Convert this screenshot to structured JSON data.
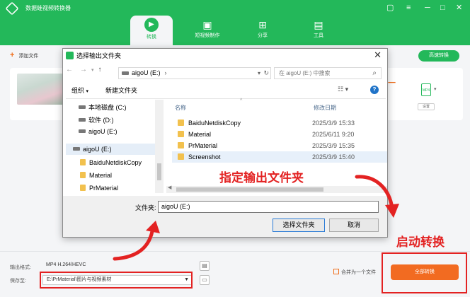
{
  "app": {
    "title": "数据蛙视频转换器",
    "window_controls": [
      "▢",
      "─",
      "□",
      "✕"
    ],
    "accent": "#23b85a",
    "orange": "#f26b21"
  },
  "nav_tabs": [
    {
      "label": "转换",
      "icon": "convert-icon"
    },
    {
      "label": "短视频制作",
      "icon": "image-icon"
    },
    {
      "label": "分享",
      "icon": "share-icon"
    },
    {
      "label": "工具",
      "icon": "toolbox-icon"
    }
  ],
  "toolbar": {
    "add_file": "添加文件",
    "fast_convert": "高速转换"
  },
  "file_card": {
    "format": "MP4",
    "settings": "设置"
  },
  "bottom": {
    "output_format_label": "输出格式:",
    "output_format_value": "MP4 H.264/HEVC",
    "save_to_label": "保存至:",
    "save_to_value": "E:\\PrMaterial\\图片与视频素材",
    "merge_label": "合并为一个文件",
    "convert_all": "全部转换"
  },
  "dialog": {
    "title": "选择输出文件夹",
    "address": "aigoU (E:)",
    "search_placeholder": "在 aigoU (E:) 中搜索",
    "organize": "组织",
    "new_folder": "新建文件夹",
    "tree": [
      "本地磁盘 (C:)",
      "软件 (D:)",
      "aigoU (E:)",
      "aigoU (E:)",
      "BaiduNetdiskCopy",
      "Material",
      "PrMaterial"
    ],
    "col_name": "名称",
    "col_date": "修改日期",
    "files": [
      {
        "name": "BaiduNetdiskCopy",
        "date": "2025/3/9 15:33"
      },
      {
        "name": "Material",
        "date": "2025/6/11 9:20"
      },
      {
        "name": "PrMaterial",
        "date": "2025/3/9 15:35"
      },
      {
        "name": "Screenshot",
        "date": "2025/3/9 15:40"
      }
    ],
    "folder_label": "文件夹:",
    "folder_value": "aigoU (E:)",
    "select_button": "选择文件夹",
    "cancel_button": "取消"
  },
  "annotations": {
    "specify_folder": "指定输出文件夹",
    "start_convert": "启动转换"
  }
}
